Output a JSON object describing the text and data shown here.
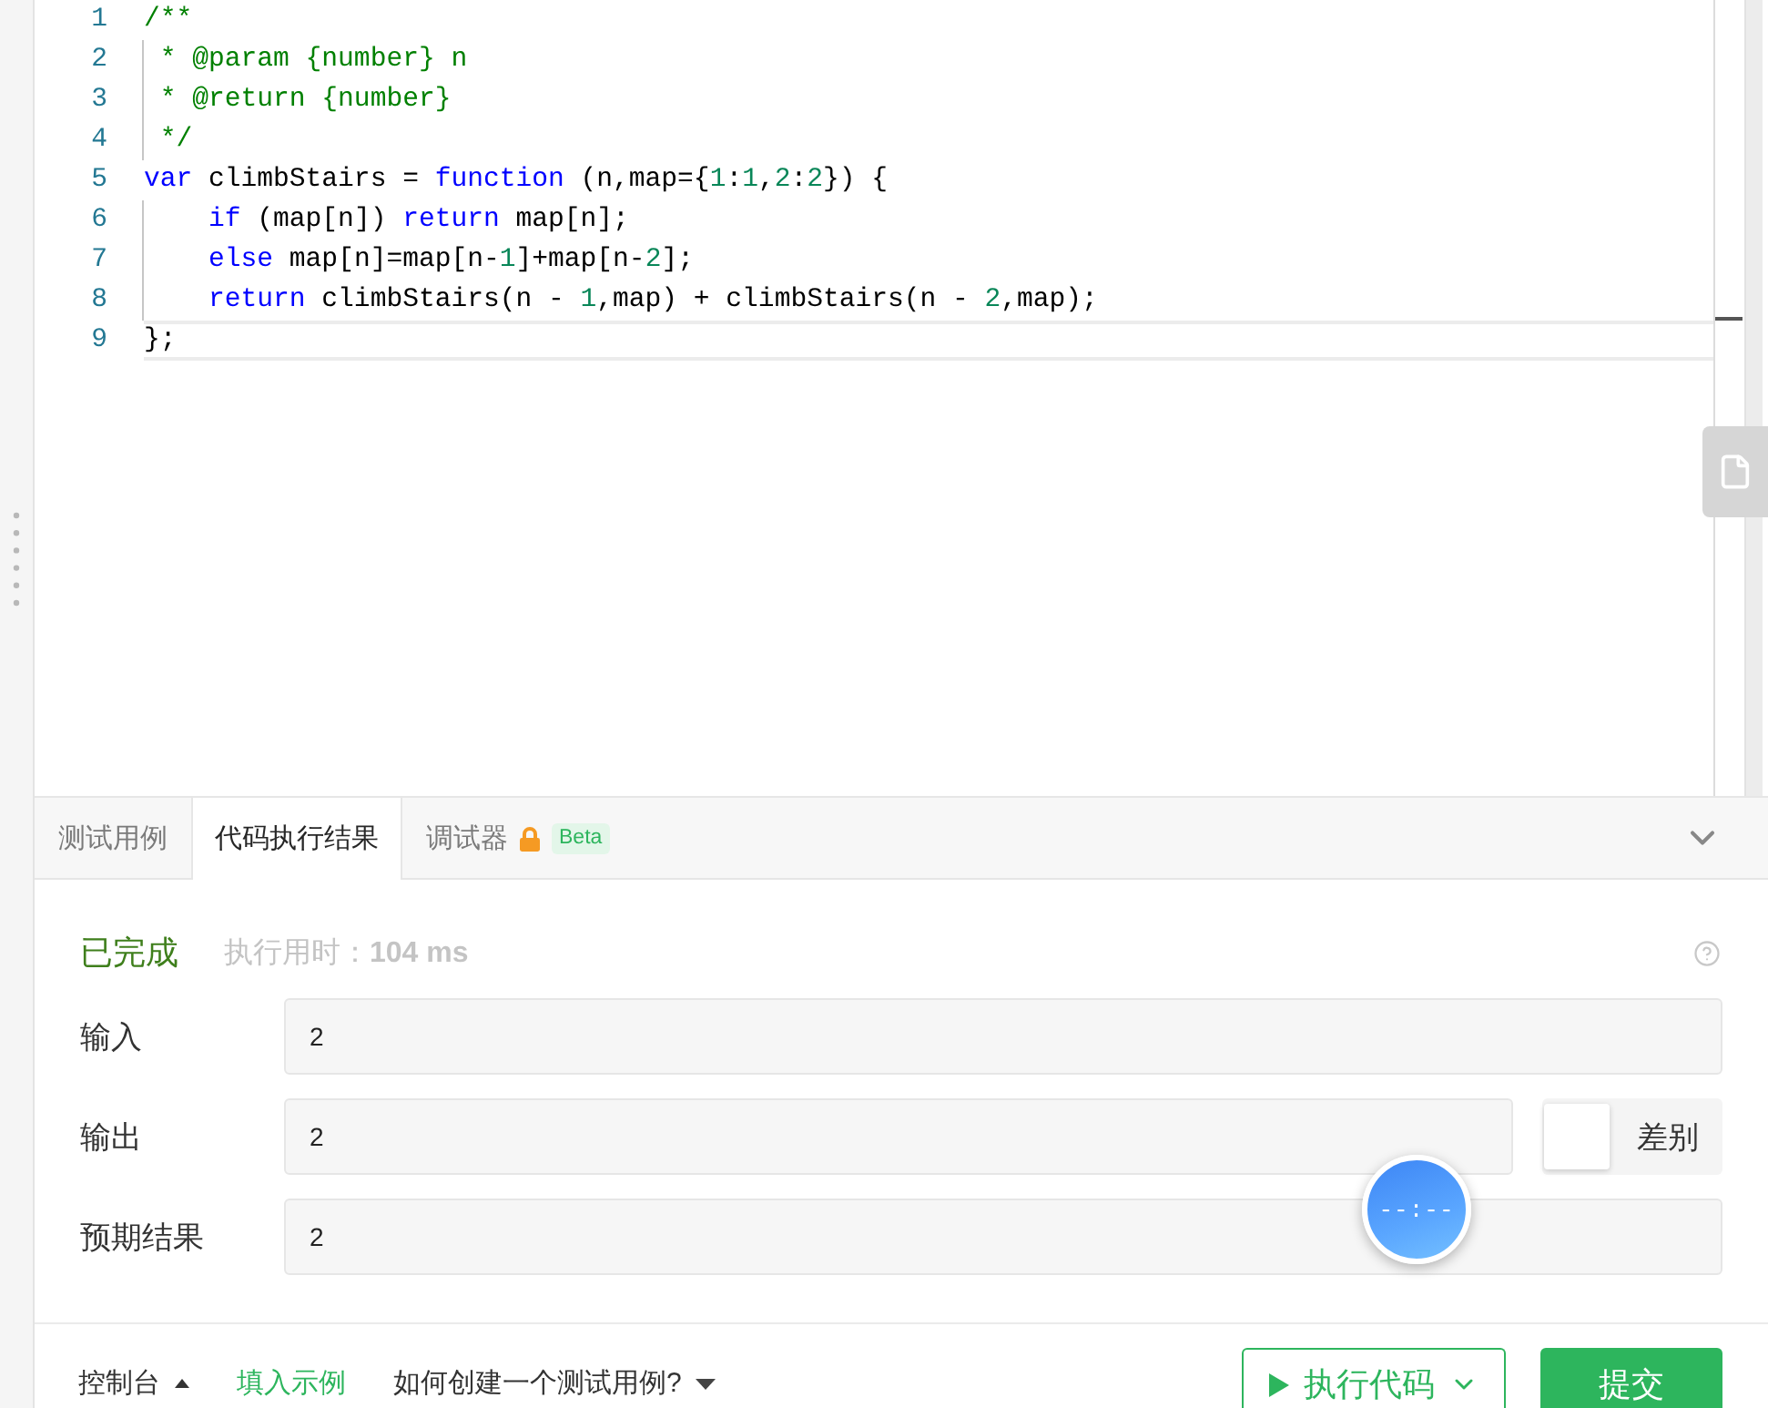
{
  "editor": {
    "lines": [
      {
        "number": "1",
        "current": false,
        "guide": false,
        "tokens": [
          {
            "kind": "comment",
            "text": "/**"
          }
        ]
      },
      {
        "number": "2",
        "current": false,
        "guide": true,
        "tokens": [
          {
            "kind": "comment",
            "text": " * @param {number} n"
          }
        ]
      },
      {
        "number": "3",
        "current": false,
        "guide": true,
        "tokens": [
          {
            "kind": "comment",
            "text": " * @return {number}"
          }
        ]
      },
      {
        "number": "4",
        "current": false,
        "guide": true,
        "tokens": [
          {
            "kind": "comment",
            "text": " */"
          }
        ]
      },
      {
        "number": "5",
        "current": false,
        "guide": false,
        "tokens": [
          {
            "kind": "keyword",
            "text": "var"
          },
          {
            "kind": "plain",
            "text": " climbStairs = "
          },
          {
            "kind": "keyword",
            "text": "function"
          },
          {
            "kind": "plain",
            "text": " (n,map={"
          },
          {
            "kind": "number",
            "text": "1"
          },
          {
            "kind": "plain",
            "text": ":"
          },
          {
            "kind": "number",
            "text": "1"
          },
          {
            "kind": "plain",
            "text": ","
          },
          {
            "kind": "number",
            "text": "2"
          },
          {
            "kind": "plain",
            "text": ":"
          },
          {
            "kind": "number",
            "text": "2"
          },
          {
            "kind": "plain",
            "text": "}) {"
          }
        ]
      },
      {
        "number": "6",
        "current": false,
        "guide": true,
        "tokens": [
          {
            "kind": "keyword",
            "text": "    if"
          },
          {
            "kind": "plain",
            "text": " (map[n]) "
          },
          {
            "kind": "keyword",
            "text": "return"
          },
          {
            "kind": "plain",
            "text": " map[n];"
          }
        ]
      },
      {
        "number": "7",
        "current": false,
        "guide": true,
        "tokens": [
          {
            "kind": "keyword",
            "text": "    else"
          },
          {
            "kind": "plain",
            "text": " map[n]=map[n-"
          },
          {
            "kind": "number",
            "text": "1"
          },
          {
            "kind": "plain",
            "text": "]+map[n-"
          },
          {
            "kind": "number",
            "text": "2"
          },
          {
            "kind": "plain",
            "text": "];"
          }
        ]
      },
      {
        "number": "8",
        "current": false,
        "guide": true,
        "tokens": [
          {
            "kind": "keyword",
            "text": "    return"
          },
          {
            "kind": "plain",
            "text": " climbStairs(n - "
          },
          {
            "kind": "number",
            "text": "1"
          },
          {
            "kind": "plain",
            "text": ",map) + climbStairs(n - "
          },
          {
            "kind": "number",
            "text": "2"
          },
          {
            "kind": "plain",
            "text": ",map);"
          }
        ]
      },
      {
        "number": "9",
        "current": true,
        "guide": false,
        "tokens": [
          {
            "kind": "plain",
            "text": "};"
          }
        ]
      }
    ]
  },
  "tabs": [
    {
      "label": "测试用例",
      "selected": false
    },
    {
      "label": "代码执行结果",
      "selected": true
    },
    {
      "label": "调试器",
      "selected": false,
      "locked": true,
      "badge": "Beta"
    }
  ],
  "result": {
    "status": "已完成",
    "runtime": "执行用时：**104 ms**",
    "fields": [
      {
        "label": "输入",
        "value": "2"
      },
      {
        "label": "输出",
        "value": "2",
        "diff": {
          "label": "差别",
          "checked": false
        }
      },
      {
        "label": "预期结果",
        "value": "2"
      }
    ]
  },
  "timer": {
    "display": "--:--"
  },
  "bottom_bar": {
    "console": "控制台",
    "fill_example": "填入示例",
    "help": "如何创建一个测试用例?",
    "run": "执行代码",
    "submit": "提交"
  }
}
